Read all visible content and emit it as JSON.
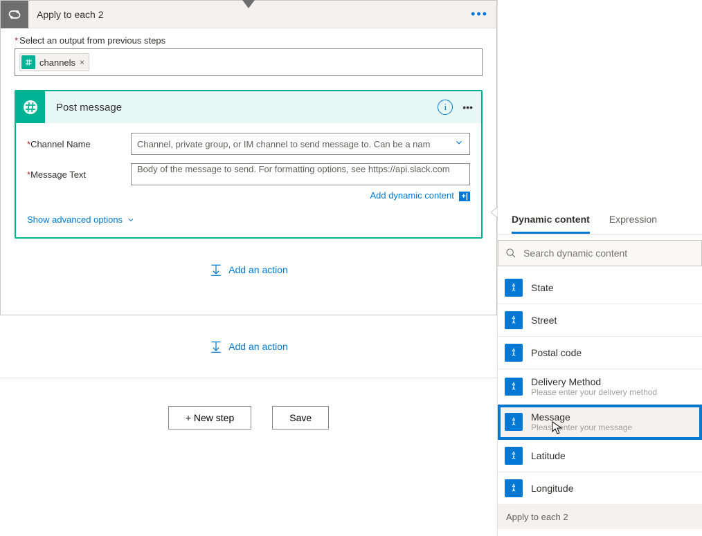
{
  "applyCard": {
    "title": "Apply to each 2",
    "outputLabel": "Select an output from previous steps",
    "chip": {
      "label": "channels"
    }
  },
  "actionCard": {
    "title": "Post message",
    "channelLabel": "Channel Name",
    "channelPlaceholder": "Channel, private group, or IM channel to send message to. Can be a nam",
    "messageLabel": "Message Text",
    "messagePlaceholder": "Body of the message to send. For formatting options, see https://api.slack.com",
    "addDynamic": "Add dynamic content",
    "advanced": "Show advanced options"
  },
  "addAction": "Add an action",
  "buttons": {
    "newStep": "+ New step",
    "save": "Save"
  },
  "dcPanel": {
    "tabs": {
      "dynamic": "Dynamic content",
      "expression": "Expression"
    },
    "searchPlaceholder": "Search dynamic content",
    "items": [
      {
        "title": "State",
        "sub": ""
      },
      {
        "title": "Street",
        "sub": ""
      },
      {
        "title": "Postal code",
        "sub": ""
      },
      {
        "title": "Delivery Method",
        "sub": "Please enter your delivery method"
      },
      {
        "title": "Message",
        "sub": "Please enter your message",
        "highlight": true
      },
      {
        "title": "Latitude",
        "sub": ""
      },
      {
        "title": "Longitude",
        "sub": ""
      }
    ],
    "sectionLabel": "Apply to each 2"
  }
}
